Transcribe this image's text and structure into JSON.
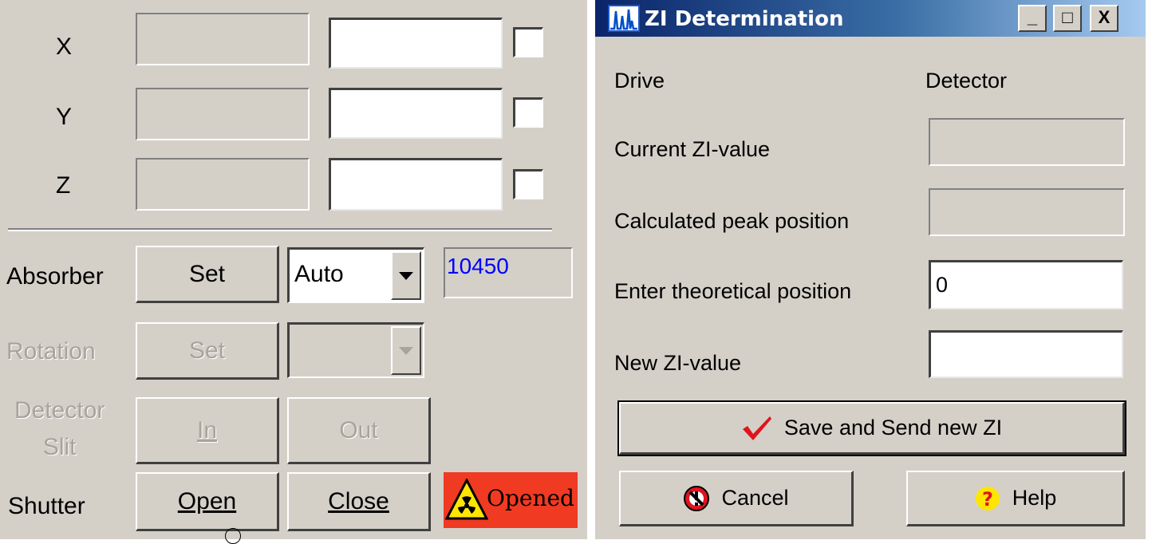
{
  "left": {
    "axes": [
      {
        "label": "X",
        "value": ""
      },
      {
        "label": "Y",
        "value": ""
      },
      {
        "label": "Z",
        "value": ""
      }
    ],
    "absorber": {
      "label": "Absorber",
      "set_label": "Set",
      "mode": "Auto",
      "value": "10450",
      "value_color": "#0000ff"
    },
    "rotation": {
      "label": "Rotation",
      "set_label": "Set"
    },
    "detector_slit": {
      "label_line1": "Detector",
      "label_line2": "Slit",
      "in_label": "In",
      "out_label": "Out"
    },
    "shutter": {
      "label": "Shutter",
      "open_label": "Open",
      "close_label": "Close",
      "status": "Opened",
      "status_color": "#f03a22"
    }
  },
  "dialog": {
    "title": "ZI Determination",
    "caption_buttons": {
      "minimize": "_",
      "maximize": "□",
      "close": "X"
    },
    "headers": {
      "drive": "Drive",
      "detector": "Detector"
    },
    "rows": {
      "current": "Current ZI-value",
      "calculated": "Calculated peak position",
      "enter": "Enter theoretical position",
      "new": "New ZI-value"
    },
    "theoretical_value": "0",
    "save_button": "Save and Send new ZI",
    "cancel_button": "Cancel",
    "help_button": "Help"
  }
}
